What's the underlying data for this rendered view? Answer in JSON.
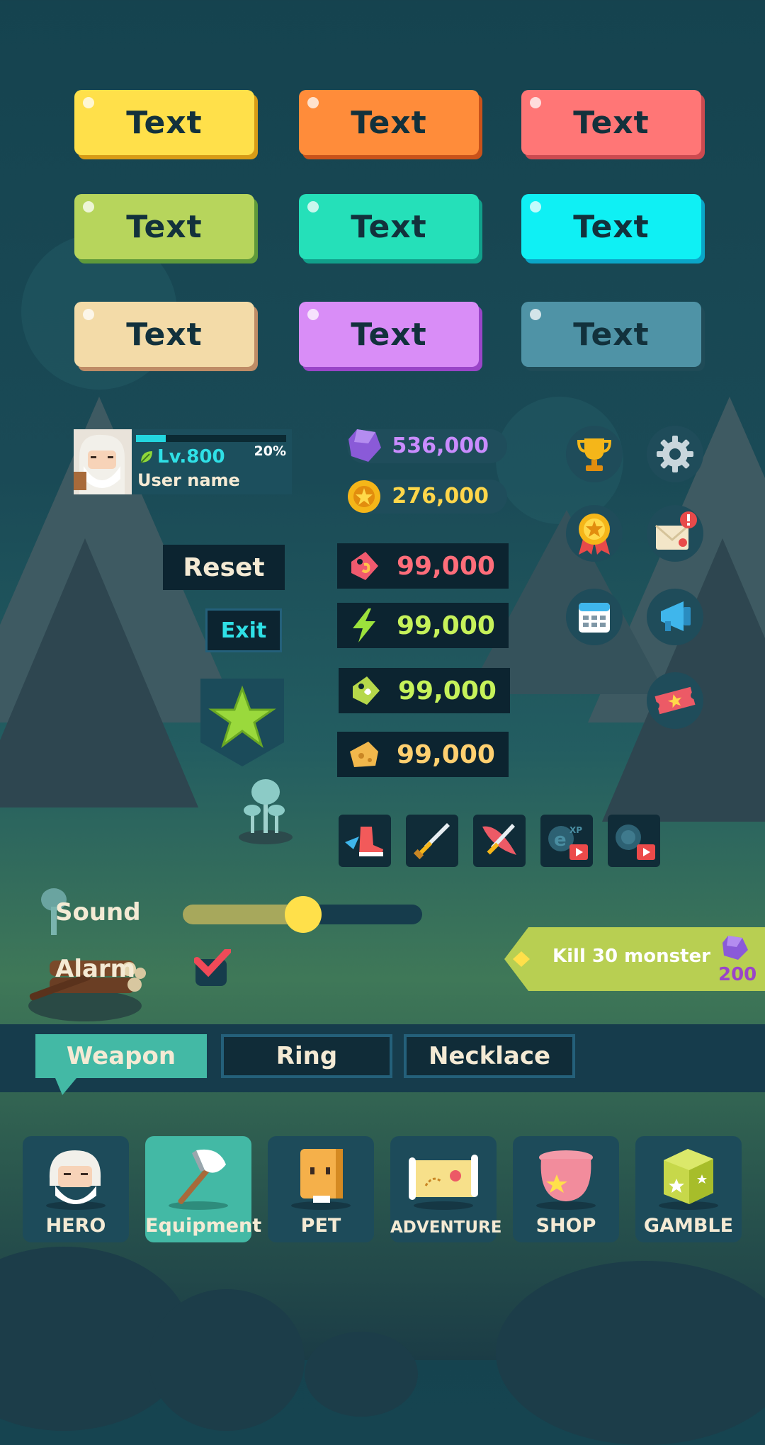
{
  "buttons": [
    {
      "label": "Text",
      "color": "#ffe04a"
    },
    {
      "label": "Text",
      "color": "#ff8c3a"
    },
    {
      "label": "Text",
      "color": "#ff7676"
    },
    {
      "label": "Text",
      "color": "#b7d55c"
    },
    {
      "label": "Text",
      "color": "#25e0b9"
    },
    {
      "label": "Text",
      "color": "#0ff0f4"
    },
    {
      "label": "Text",
      "color": "#f3dba8"
    },
    {
      "label": "Text",
      "color": "#d98df7"
    },
    {
      "label": "Text",
      "color": "#4f93a6"
    }
  ],
  "profile": {
    "level": "Lv.800",
    "xp_percent": "20%",
    "xp_fraction": 0.2,
    "username": "User name"
  },
  "currencies": {
    "gems": "536,000",
    "coins": "276,000"
  },
  "actions": {
    "reset": "Reset",
    "exit": "Exit"
  },
  "resources": [
    {
      "icon": "red-tag-icon",
      "value": "99,000",
      "color": "#ff6d7a"
    },
    {
      "icon": "lightning-icon",
      "value": "99,000",
      "color": "#c6f25a"
    },
    {
      "icon": "green-tag-icon",
      "value": "99,000",
      "color": "#c6f25a"
    },
    {
      "icon": "cheese-icon",
      "value": "99,000",
      "color": "#ffd070"
    }
  ],
  "round_icons": [
    "trophy-icon",
    "gear-icon",
    "medal-icon",
    "mail-icon",
    "calendar-icon",
    "megaphone-icon",
    "ticket-icon"
  ],
  "skills": [
    "boot-skill-icon",
    "sword-skill-icon",
    "fire-sword-skill-icon",
    "exp-video-icon",
    "coin-video-icon"
  ],
  "settings": {
    "sound_label": "Sound",
    "sound_level": 0.5,
    "alarm_label": "Alarm",
    "alarm_checked": true
  },
  "quest": {
    "text": "Kill 30 monster",
    "reward": "200"
  },
  "tabs": [
    {
      "label": "Weapon",
      "active": true
    },
    {
      "label": "Ring",
      "active": false
    },
    {
      "label": "Necklace",
      "active": false
    }
  ],
  "nav": [
    {
      "label": "HERO",
      "active": false
    },
    {
      "label": "Equipment",
      "active": true
    },
    {
      "label": "PET",
      "active": false
    },
    {
      "label": "ADVENTURE",
      "active": false
    },
    {
      "label": "SHOP",
      "active": false
    },
    {
      "label": "GAMBLE",
      "active": false
    }
  ]
}
